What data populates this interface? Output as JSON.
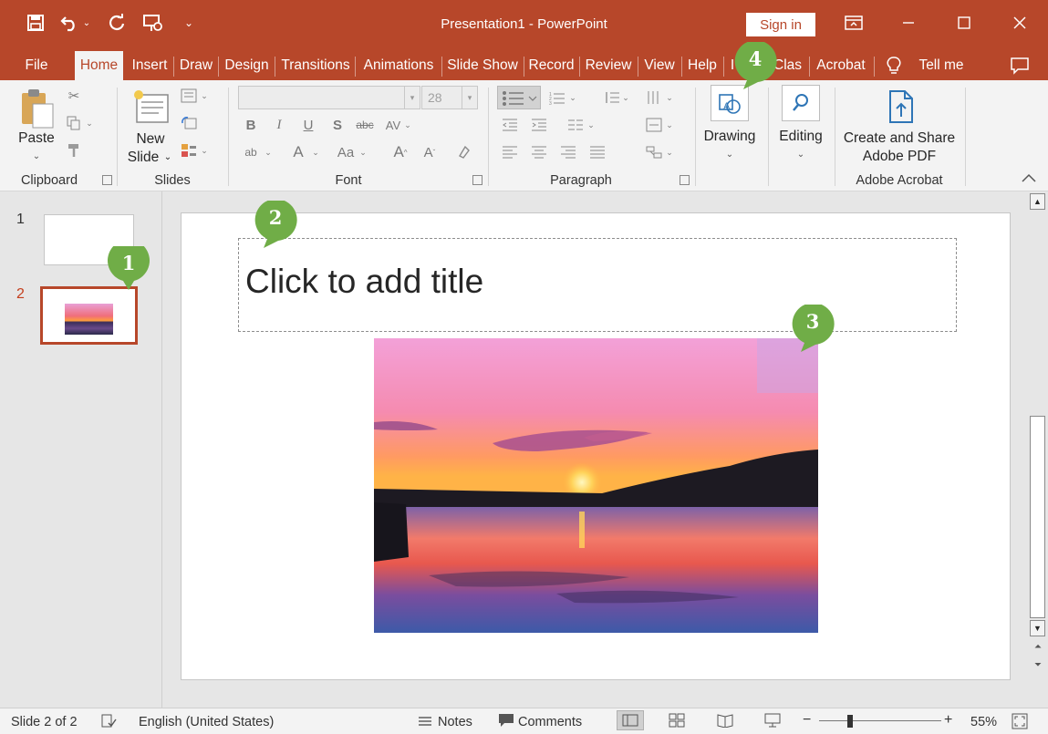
{
  "window": {
    "doc_title": "Presentation1  -  PowerPoint",
    "sign_in": "Sign in"
  },
  "tabs": [
    "File",
    "Home",
    "Insert",
    "Draw",
    "Design",
    "Transitions",
    "Animations",
    "Slide Show",
    "Record",
    "Review",
    "View",
    "Help",
    "I",
    "Clas",
    "Acrobat",
    "Tell me"
  ],
  "ribbon": {
    "groups": {
      "clipboard": "Clipboard",
      "slides": "Slides",
      "font": "Font",
      "paragraph": "Paragraph",
      "adobe": "Adobe Acrobat"
    },
    "paste": "Paste",
    "new_slide_1": "New",
    "new_slide_2": "Slide",
    "font_size": "28",
    "drawing": "Drawing",
    "editing": "Editing",
    "create_share_1": "Create and Share",
    "create_share_2": "Adobe PDF"
  },
  "thumbnails": [
    {
      "number": "1"
    },
    {
      "number": "2"
    }
  ],
  "slide": {
    "title_placeholder": "Click to add title"
  },
  "callouts": [
    "1",
    "2",
    "3",
    "4"
  ],
  "status": {
    "slide_count": "Slide 2 of 2",
    "language": "English (United States)",
    "notes": "Notes",
    "comments": "Comments",
    "zoom": "55%"
  },
  "colors": {
    "accent": "#b7472a",
    "callout_green": "#70ad47"
  }
}
